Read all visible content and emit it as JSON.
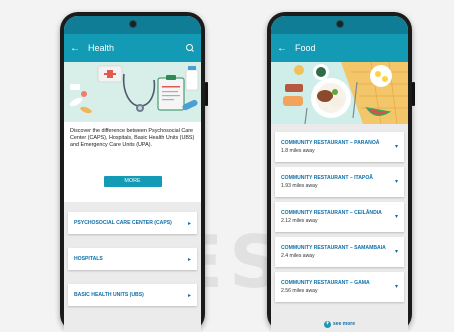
{
  "watermark": "RESS",
  "health": {
    "title": "Health",
    "back_icon": "arrow-left-icon",
    "search_icon": "search-icon",
    "description": "Discover the difference between Psychosocial Care Center (CAPS), Hospitals, Basic Health Units (UBS) and Emergency Care Units (UPA).",
    "more_label": "MORE",
    "items": [
      {
        "label": "PSYCHOSOCIAL CARE CENTER (CAPS)"
      },
      {
        "label": "HOSPITALS"
      },
      {
        "label": "BASIC HEALTH UNITS (UBS)"
      }
    ]
  },
  "food": {
    "title": "Food",
    "back_icon": "arrow-left-icon",
    "restaurants": [
      {
        "name": "COMMUNITY RESTAURANT – PARANOÁ",
        "distance": "1.8 miles away"
      },
      {
        "name": "COMMUNITY RESTAURANT – ITAPOÃ",
        "distance": "1.93 miles away"
      },
      {
        "name": "COMMUNITY RESTAURANT – CEILÂNDIA",
        "distance": "2.12 miles away"
      },
      {
        "name": "COMMUNITY RESTAURANT – SAMAMBAIA",
        "distance": "2.4 miles away"
      },
      {
        "name": "COMMUNITY RESTAURANT – GAMA",
        "distance": "2.56 miles away"
      }
    ],
    "see_more": "see more"
  },
  "colors": {
    "app_bar": "#139ab5",
    "status_bar": "#0f7d96",
    "link_text": "#0e6fa8"
  }
}
